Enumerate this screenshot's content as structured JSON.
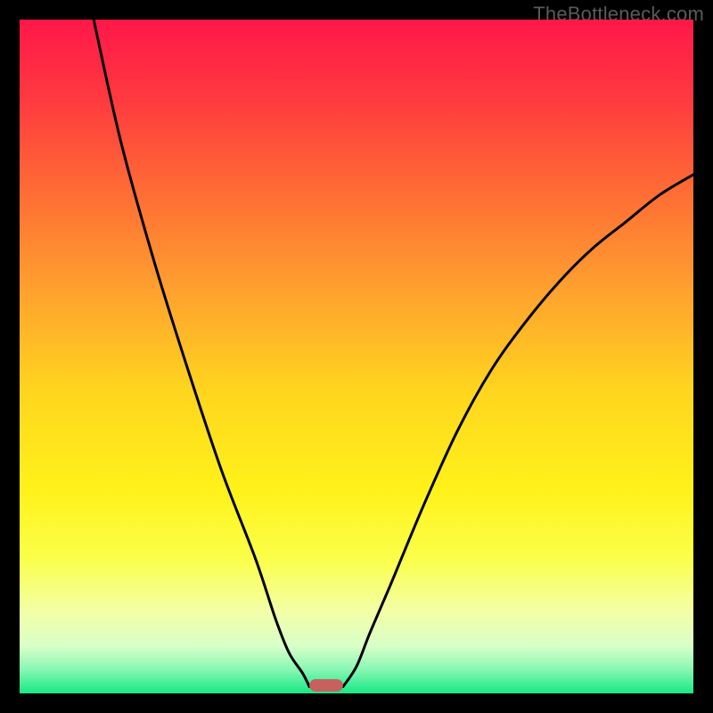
{
  "watermark": "TheBottleneck.com",
  "chart_data": {
    "type": "line",
    "title": "",
    "xlabel": "",
    "ylabel": "",
    "xlim": [
      0,
      100
    ],
    "ylim": [
      0,
      100
    ],
    "grid": false,
    "legend": false,
    "series": [
      {
        "name": "left-curve",
        "x": [
          11,
          15,
          20,
          25,
          30,
          35,
          38,
          40,
          42,
          43
        ],
        "y": [
          100,
          82,
          64,
          48,
          33,
          20,
          11,
          6,
          3,
          1
        ]
      },
      {
        "name": "right-curve",
        "x": [
          48,
          50,
          52,
          55,
          60,
          65,
          70,
          75,
          80,
          85,
          90,
          95,
          100
        ],
        "y": [
          1,
          4,
          9,
          16,
          28,
          39,
          48,
          55,
          61,
          66,
          70,
          74,
          77
        ]
      }
    ],
    "marker": {
      "name": "bottleneck-marker",
      "x_center": 45.5,
      "width": 5,
      "color": "#c86060"
    },
    "gradient_stops": [
      {
        "offset": 0.0,
        "color": "#ff1749"
      },
      {
        "offset": 0.12,
        "color": "#ff3a3f"
      },
      {
        "offset": 0.25,
        "color": "#ff6a35"
      },
      {
        "offset": 0.4,
        "color": "#ffa02f"
      },
      {
        "offset": 0.55,
        "color": "#ffd51e"
      },
      {
        "offset": 0.7,
        "color": "#fff21a"
      },
      {
        "offset": 0.8,
        "color": "#fbff4a"
      },
      {
        "offset": 0.88,
        "color": "#f2ffa8"
      },
      {
        "offset": 0.93,
        "color": "#d8ffc8"
      },
      {
        "offset": 0.965,
        "color": "#86f7b4"
      },
      {
        "offset": 1.0,
        "color": "#17e884"
      }
    ]
  }
}
